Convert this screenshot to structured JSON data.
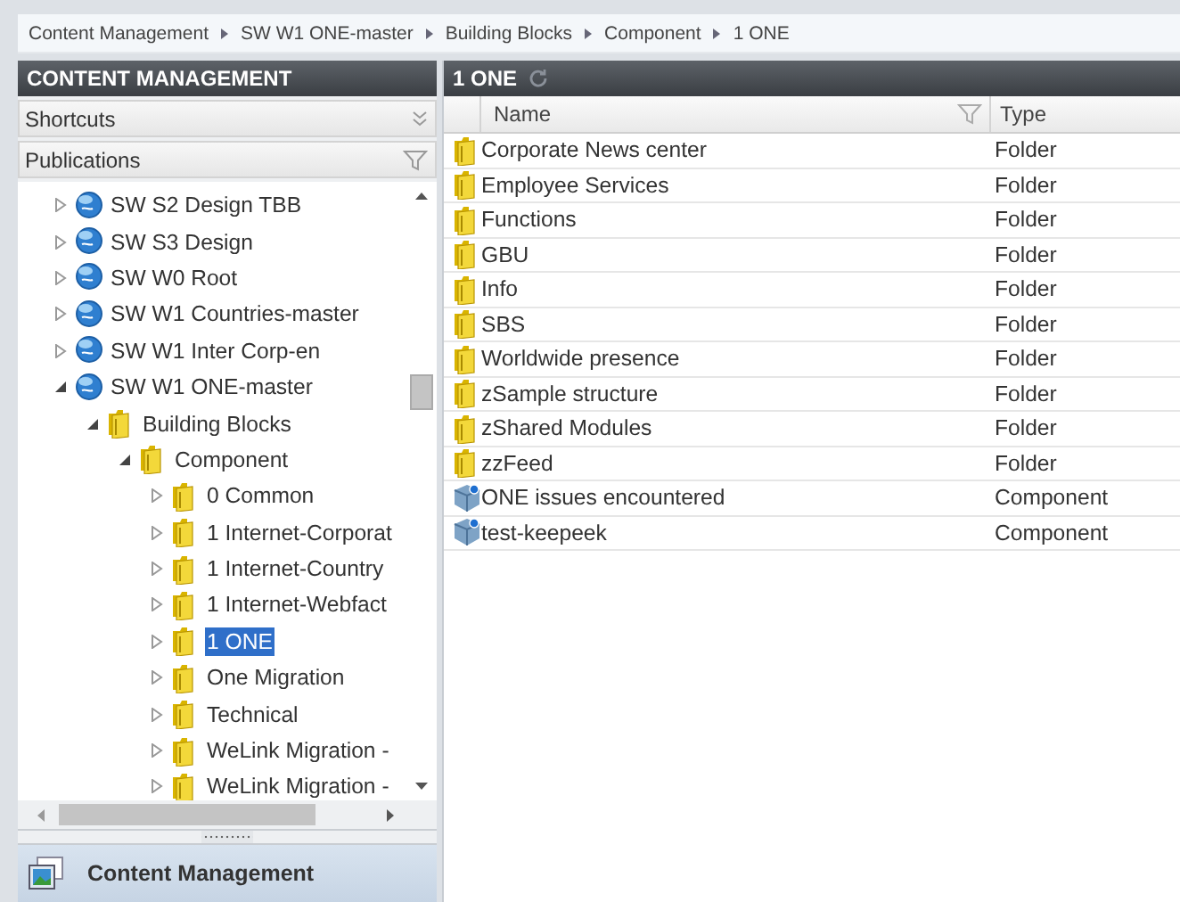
{
  "breadcrumb": [
    "Content Management",
    "SW W1 ONE-master",
    "Building Blocks",
    "Component",
    "1 ONE"
  ],
  "left_panel": {
    "title": "CONTENT MANAGEMENT",
    "shortcuts": {
      "label": "Shortcuts"
    },
    "publications": {
      "label": "Publications"
    },
    "tree": [
      {
        "label": "SW S2 Design TBB",
        "kind": "publication",
        "expanded": false,
        "selected": false
      },
      {
        "label": "SW S3 Design",
        "kind": "publication",
        "expanded": false,
        "selected": false
      },
      {
        "label": "SW W0 Root",
        "kind": "publication",
        "expanded": false,
        "selected": false
      },
      {
        "label": "SW W1 Countries-master",
        "kind": "publication",
        "expanded": false,
        "selected": false
      },
      {
        "label": "SW W1 Inter Corp-en",
        "kind": "publication",
        "expanded": false,
        "selected": false
      },
      {
        "label": "SW W1 ONE-master",
        "kind": "publication",
        "expanded": true,
        "selected": false,
        "children": [
          {
            "label": "Building Blocks",
            "kind": "folder",
            "expanded": true,
            "selected": false,
            "children": [
              {
                "label": "Component",
                "kind": "folder",
                "expanded": true,
                "selected": false,
                "children": [
                  {
                    "label": "0 Common",
                    "kind": "folder",
                    "expanded": false,
                    "selected": false
                  },
                  {
                    "label": "1 Internet-Corporat",
                    "kind": "folder",
                    "expanded": false,
                    "selected": false
                  },
                  {
                    "label": "1 Internet-Country",
                    "kind": "folder",
                    "expanded": false,
                    "selected": false
                  },
                  {
                    "label": "1 Internet-Webfact",
                    "kind": "folder",
                    "expanded": false,
                    "selected": false
                  },
                  {
                    "label": "1 ONE",
                    "kind": "folder",
                    "expanded": false,
                    "selected": true
                  },
                  {
                    "label": "One Migration",
                    "kind": "folder",
                    "expanded": false,
                    "selected": false
                  },
                  {
                    "label": "Technical",
                    "kind": "folder",
                    "expanded": false,
                    "selected": false
                  },
                  {
                    "label": "WeLink Migration -",
                    "kind": "folder",
                    "expanded": false,
                    "selected": false
                  },
                  {
                    "label": "WeLink Migration -",
                    "kind": "folder",
                    "expanded": false,
                    "selected": false
                  }
                ]
              }
            ]
          }
        ]
      }
    ]
  },
  "nav_footer": {
    "label": "Content Management"
  },
  "right_panel": {
    "title": "1 ONE",
    "columns": [
      "Name",
      "Type"
    ],
    "rows": [
      {
        "name": "Corporate News center",
        "type": "Folder",
        "kind": "folder"
      },
      {
        "name": "Employee Services",
        "type": "Folder",
        "kind": "folder"
      },
      {
        "name": "Functions",
        "type": "Folder",
        "kind": "folder"
      },
      {
        "name": "GBU",
        "type": "Folder",
        "kind": "folder"
      },
      {
        "name": "Info",
        "type": "Folder",
        "kind": "folder"
      },
      {
        "name": "SBS",
        "type": "Folder",
        "kind": "folder"
      },
      {
        "name": "Worldwide presence",
        "type": "Folder",
        "kind": "folder"
      },
      {
        "name": "zSample structure",
        "type": "Folder",
        "kind": "folder"
      },
      {
        "name": "zShared Modules",
        "type": "Folder",
        "kind": "folder"
      },
      {
        "name": "zzFeed",
        "type": "Folder",
        "kind": "folder"
      },
      {
        "name": "ONE issues encountered",
        "type": "Component",
        "kind": "component"
      },
      {
        "name": "test-keepeek",
        "type": "Component",
        "kind": "component"
      }
    ]
  }
}
